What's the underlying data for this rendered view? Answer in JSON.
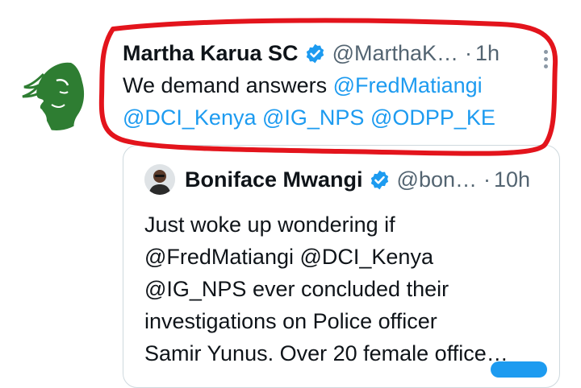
{
  "tweet": {
    "name": "Martha Karua SC",
    "handle": "@MarthaK…",
    "separator": "·",
    "time": "1h",
    "text": "We demand answers",
    "mentions": [
      "@FredMatiangi",
      "@DCI_Kenya",
      "@IG_NPS",
      "@ODPP_KE"
    ]
  },
  "quoted_tweet": {
    "name": "Boniface Mwangi",
    "handle": "@bon…",
    "separator": "·",
    "time": "10h",
    "text_lines": [
      "Just woke up wondering if",
      "@FredMatiangi @DCI_Kenya",
      "@IG_NPS ever concluded their",
      "investigations on Police officer",
      "Samir Yunus. Over 20 female office…"
    ]
  },
  "icons": {
    "verified": "verified-badge-icon",
    "more": "more-options-icon"
  },
  "colors": {
    "link": "#1d9bf0",
    "annotation": "#e3141c",
    "avatar_green": "#2e7d32"
  }
}
